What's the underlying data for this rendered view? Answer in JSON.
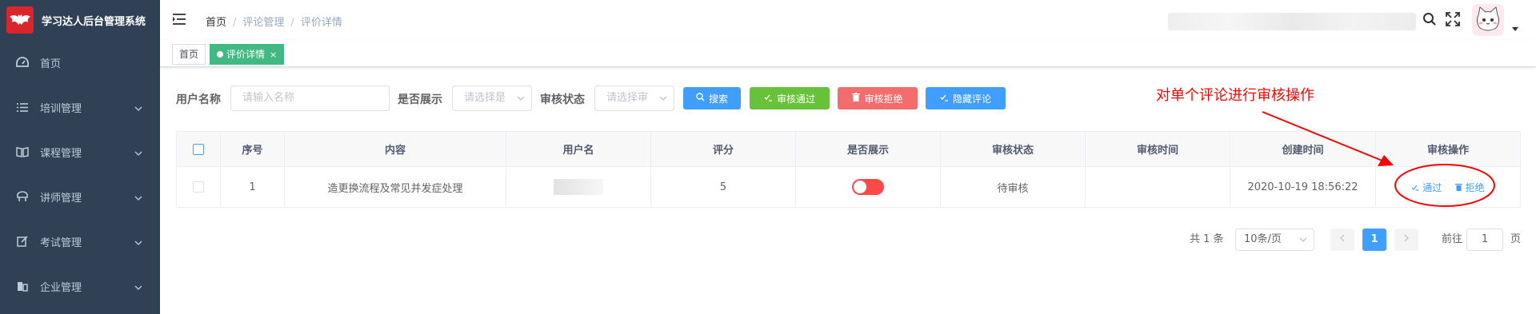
{
  "app": {
    "title": "学习达人后台管理系统",
    "brand_color": "#d8262c"
  },
  "sidebar": {
    "bg": "#304156",
    "items": [
      {
        "label": "首页",
        "icon": "dashboard-icon",
        "has_arrow": false
      },
      {
        "label": "培训管理",
        "icon": "list-icon",
        "has_arrow": true
      },
      {
        "label": "课程管理",
        "icon": "book-icon",
        "has_arrow": true
      },
      {
        "label": "讲师管理",
        "icon": "teacher-icon",
        "has_arrow": true
      },
      {
        "label": "考试管理",
        "icon": "edit-icon",
        "has_arrow": true
      },
      {
        "label": "企业管理",
        "icon": "company-icon",
        "has_arrow": true
      }
    ]
  },
  "breadcrumb": {
    "items": [
      "首页",
      "评论管理",
      "评价详情"
    ]
  },
  "tags": {
    "items": [
      "首页",
      "评价详情"
    ],
    "close_symbol": "×"
  },
  "filters": {
    "username_label": "用户名称",
    "username_placeholder": "请输入名称",
    "show_label": "是否展示",
    "show_placeholder": "请选择是",
    "status_label": "审核状态",
    "status_placeholder": "请选择审"
  },
  "buttons": {
    "search": "搜索",
    "approve": "审核通过",
    "reject": "审核拒绝",
    "hide": "隐藏评论"
  },
  "annotation": "对单个评论进行审核操作",
  "table": {
    "columns": [
      "序号",
      "内容",
      "用户名",
      "评分",
      "是否展示",
      "审核状态",
      "审核时间",
      "创建时间",
      "审核操作"
    ],
    "rows": [
      {
        "index": "1",
        "content": "造更换流程及常见并发症处理",
        "username": "",
        "score": "5",
        "shown": false,
        "status": "待审核",
        "review_time": "",
        "created": "2020-10-19 18:56:22",
        "ops": [
          "通过",
          "拒绝"
        ]
      }
    ]
  },
  "pagination": {
    "total_text": "共 1 条",
    "page_size": "10条/页",
    "current_page": "1",
    "goto_prefix": "前往",
    "goto_value": "1",
    "goto_suffix": "页"
  },
  "colors": {
    "primary": "#409eff",
    "success": "#67c23a",
    "danger": "#f56c6c",
    "tag_active": "#42b983",
    "annotation": "#ff0000"
  }
}
